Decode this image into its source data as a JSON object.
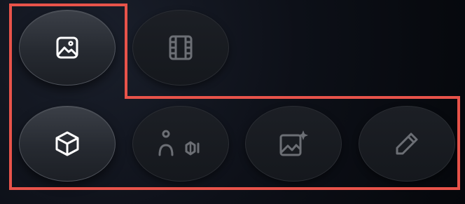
{
  "highlight_color": "#e8534a",
  "active_icon_color": "#ffffff",
  "inactive_icon_color": "#6c6f75",
  "buttons": [
    {
      "id": "image",
      "icon": "image-icon",
      "state": "active"
    },
    {
      "id": "video",
      "icon": "film-icon",
      "state": "inactive"
    },
    {
      "id": "3d",
      "icon": "cube-icon",
      "state": "active"
    },
    {
      "id": "avatar",
      "icon": "person-shield-icon",
      "state": "inactive"
    },
    {
      "id": "image-ai",
      "icon": "image-sparkle-icon",
      "state": "inactive"
    },
    {
      "id": "edit",
      "icon": "pencil-icon",
      "state": "inactive"
    }
  ]
}
